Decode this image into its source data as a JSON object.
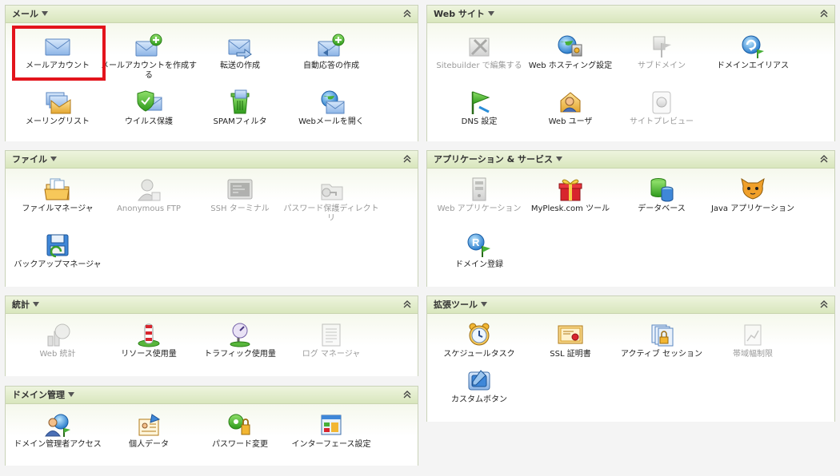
{
  "colors": {
    "accent_green": "#4aa82e",
    "header_gradient_top": "#eef4de",
    "header_gradient_bottom": "#d9e6bd",
    "highlight_red": "#e3141c",
    "disabled_text": "#9a9a9a"
  },
  "panels": {
    "mail": {
      "title": "メール",
      "items": [
        {
          "label": "メールアカウント",
          "icon": "mail-envelope-icon",
          "enabled": true,
          "highlighted": true
        },
        {
          "label": "メールアカウントを作成する",
          "icon": "mail-add-icon",
          "enabled": true
        },
        {
          "label": "転送の作成",
          "icon": "mail-forward-icon",
          "enabled": true
        },
        {
          "label": "自動応答の作成",
          "icon": "auto-reply-add-icon",
          "enabled": true
        },
        {
          "label": "メーリングリスト",
          "icon": "mailing-list-icon",
          "enabled": true
        },
        {
          "label": "ウイルス保護",
          "icon": "virus-shield-icon",
          "enabled": true
        },
        {
          "label": "SPAMフィルタ",
          "icon": "spam-filter-icon",
          "enabled": true
        },
        {
          "label": "Webメールを開く",
          "icon": "webmail-globe-icon",
          "enabled": true
        }
      ]
    },
    "website": {
      "title": "Web サイト",
      "items": [
        {
          "label": "Sitebuilder で編集する",
          "icon": "sitebuilder-tools-icon",
          "enabled": false
        },
        {
          "label": "Web ホスティング設定",
          "icon": "web-hosting-icon",
          "enabled": true
        },
        {
          "label": "サブドメイン",
          "icon": "subdomain-icon",
          "enabled": false
        },
        {
          "label": "ドメインエイリアス",
          "icon": "domain-alias-icon",
          "enabled": true
        },
        {
          "label": "DNS 設定",
          "icon": "dns-flag-icon",
          "enabled": true
        },
        {
          "label": "Web ユーザ",
          "icon": "web-user-icon",
          "enabled": true
        },
        {
          "label": "サイトプレビュー",
          "icon": "site-preview-icon",
          "enabled": false
        }
      ]
    },
    "files": {
      "title": "ファイル",
      "items": [
        {
          "label": "ファイルマネージャ",
          "icon": "file-manager-icon",
          "enabled": true
        },
        {
          "label": "Anonymous FTP",
          "icon": "anonymous-ftp-icon",
          "enabled": false
        },
        {
          "label": "SSH ターミナル",
          "icon": "ssh-terminal-icon",
          "enabled": false
        },
        {
          "label": "パスワード保護ディレクトリ",
          "icon": "protected-folder-icon",
          "enabled": false
        },
        {
          "label": "バックアップマネージャ",
          "icon": "backup-manager-icon",
          "enabled": true
        }
      ]
    },
    "apps": {
      "title": "アプリケーション & サービス",
      "items": [
        {
          "label": "Web アプリケーション",
          "icon": "web-applications-icon",
          "enabled": false
        },
        {
          "label": "MyPlesk.com ツール",
          "icon": "gift-box-icon",
          "enabled": true
        },
        {
          "label": "データベース",
          "icon": "database-icon",
          "enabled": true
        },
        {
          "label": "Java アプリケーション",
          "icon": "java-tomcat-icon",
          "enabled": true
        },
        {
          "label": "ドメイン登録",
          "icon": "domain-registration-icon",
          "enabled": true
        }
      ]
    },
    "stats": {
      "title": "統計",
      "items": [
        {
          "label": "Web 統計",
          "icon": "web-stats-icon",
          "enabled": false
        },
        {
          "label": "リソース使用量",
          "icon": "resource-usage-icon",
          "enabled": true
        },
        {
          "label": "トラフィック使用量",
          "icon": "traffic-usage-icon",
          "enabled": true
        },
        {
          "label": "ログ マネージャ",
          "icon": "log-manager-icon",
          "enabled": false
        }
      ]
    },
    "ext": {
      "title": "拡張ツール",
      "items": [
        {
          "label": "スケジュールタスク",
          "icon": "alarm-clock-icon",
          "enabled": true
        },
        {
          "label": "SSL 証明書",
          "icon": "ssl-certificate-icon",
          "enabled": true
        },
        {
          "label": "アクティブ セッション",
          "icon": "active-sessions-icon",
          "enabled": true
        },
        {
          "label": "帯域幅制限",
          "icon": "bandwidth-limit-icon",
          "enabled": false
        },
        {
          "label": "カスタムボタン",
          "icon": "custom-buttons-icon",
          "enabled": true
        }
      ]
    },
    "domadmin": {
      "title": "ドメイン管理",
      "items": [
        {
          "label": "ドメイン管理者アクセス",
          "icon": "domain-admin-access-icon",
          "enabled": true
        },
        {
          "label": "個人データ",
          "icon": "personal-data-icon",
          "enabled": true
        },
        {
          "label": "パスワード変更",
          "icon": "password-change-icon",
          "enabled": true
        },
        {
          "label": "インターフェース設定",
          "icon": "interface-settings-icon",
          "enabled": true
        }
      ]
    }
  }
}
